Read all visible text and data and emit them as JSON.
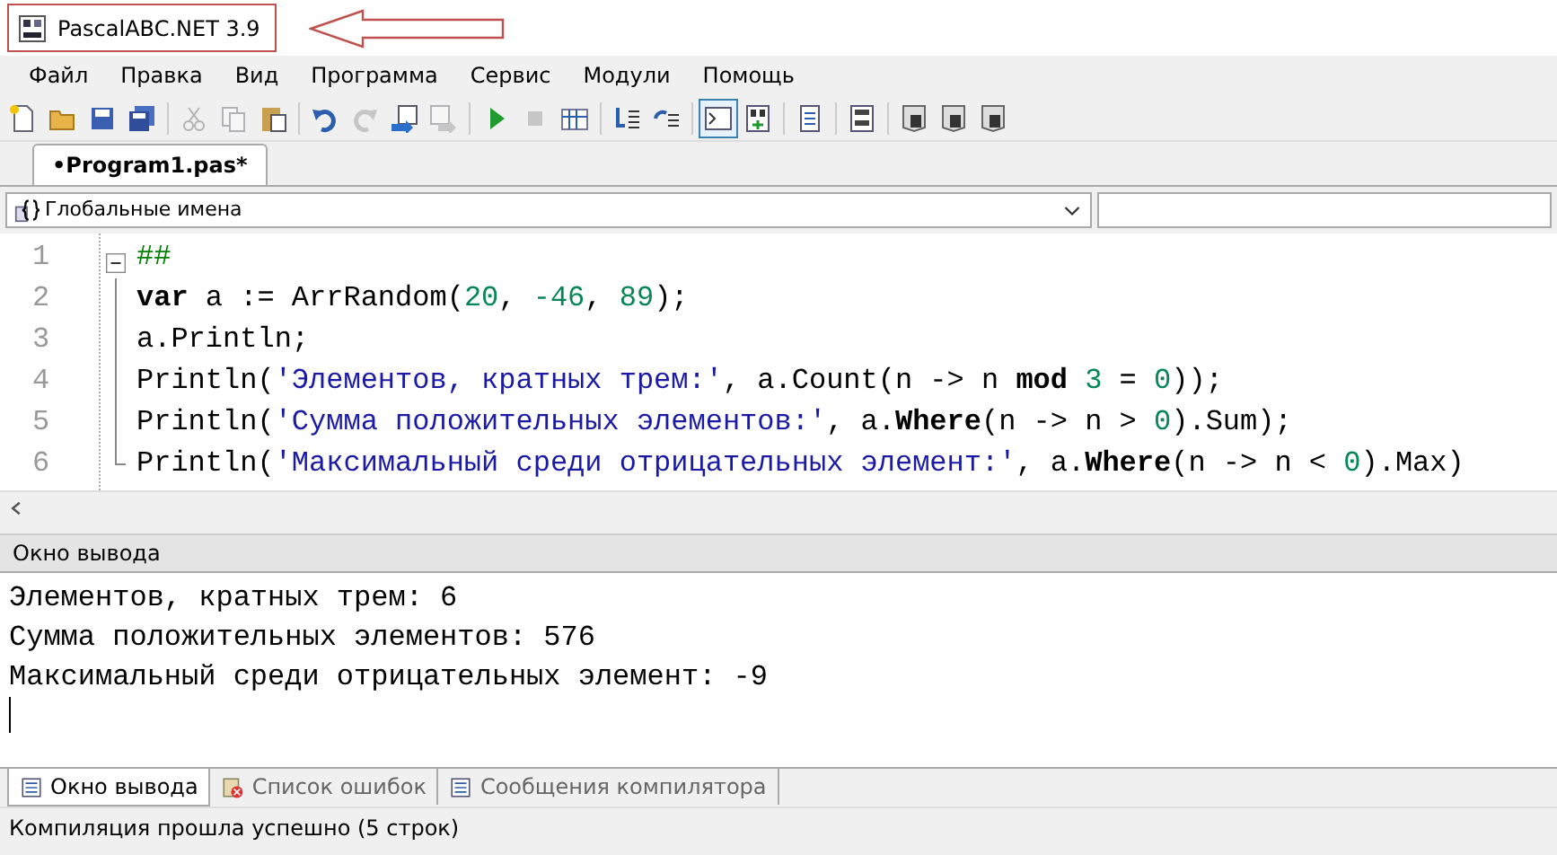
{
  "window": {
    "title": "PascalABC.NET 3.9"
  },
  "menu": [
    "Файл",
    "Правка",
    "Вид",
    "Программа",
    "Сервис",
    "Модули",
    "Помощь"
  ],
  "toolbar": [
    [
      {
        "kind": "new",
        "disabled": false
      },
      {
        "kind": "open",
        "disabled": false
      },
      {
        "kind": "save",
        "disabled": false
      },
      {
        "kind": "save-all",
        "disabled": false
      }
    ],
    [
      {
        "kind": "cut",
        "disabled": true
      },
      {
        "kind": "copy",
        "disabled": true
      },
      {
        "kind": "paste",
        "disabled": false
      }
    ],
    [
      {
        "kind": "undo",
        "disabled": false
      },
      {
        "kind": "redo",
        "disabled": true
      },
      {
        "kind": "doc-left",
        "disabled": false
      },
      {
        "kind": "doc-right",
        "disabled": true
      }
    ],
    [
      {
        "kind": "run",
        "disabled": false
      },
      {
        "kind": "stop",
        "disabled": true
      },
      {
        "kind": "grid",
        "disabled": false
      }
    ],
    [
      {
        "kind": "step-in",
        "disabled": false
      },
      {
        "kind": "step-over",
        "disabled": false
      }
    ],
    [
      {
        "kind": "console",
        "disabled": false,
        "selected": true
      },
      {
        "kind": "abc",
        "disabled": false
      }
    ],
    [
      {
        "kind": "page",
        "disabled": false
      }
    ],
    [
      {
        "kind": "code",
        "disabled": false
      }
    ],
    [
      {
        "kind": "doc",
        "disabled": false
      },
      {
        "kind": "doc",
        "disabled": false
      },
      {
        "kind": "doc",
        "disabled": false
      }
    ]
  ],
  "editor_tabs": [
    {
      "label": "•Program1.pas*",
      "selected": true
    }
  ],
  "scope_selector": {
    "value": "Глобальные имена"
  },
  "code": {
    "fold_expanded": true,
    "lines": [
      {
        "number": "1",
        "tokens": [
          {
            "kind": "comment",
            "text": "##"
          }
        ]
      },
      {
        "number": "2",
        "tokens": [
          {
            "kind": "keyword",
            "text": "var"
          },
          {
            "kind": "plain",
            "text": " a := ArrRandom("
          },
          {
            "kind": "number",
            "text": "20"
          },
          {
            "kind": "plain",
            "text": ", "
          },
          {
            "kind": "number",
            "text": "-46"
          },
          {
            "kind": "plain",
            "text": ", "
          },
          {
            "kind": "number",
            "text": "89"
          },
          {
            "kind": "plain",
            "text": ");"
          }
        ]
      },
      {
        "number": "3",
        "tokens": [
          {
            "kind": "plain",
            "text": "a.Println;"
          }
        ]
      },
      {
        "number": "4",
        "tokens": [
          {
            "kind": "plain",
            "text": "Println("
          },
          {
            "kind": "string",
            "text": "'Элементов, кратных трем:'"
          },
          {
            "kind": "plain",
            "text": ", a.Count(n -> n "
          },
          {
            "kind": "keyword",
            "text": "mod"
          },
          {
            "kind": "number",
            "text": " 3"
          },
          {
            "kind": "plain",
            "text": " = "
          },
          {
            "kind": "number",
            "text": "0"
          },
          {
            "kind": "plain",
            "text": "));"
          }
        ]
      },
      {
        "number": "5",
        "tokens": [
          {
            "kind": "plain",
            "text": "Println("
          },
          {
            "kind": "string",
            "text": "'Сумма положительных элементов:'"
          },
          {
            "kind": "plain",
            "text": ", a."
          },
          {
            "kind": "keyword",
            "text": "Where"
          },
          {
            "kind": "plain",
            "text": "(n -> n > "
          },
          {
            "kind": "number",
            "text": "0"
          },
          {
            "kind": "plain",
            "text": ").Sum);"
          }
        ]
      },
      {
        "number": "6",
        "tokens": [
          {
            "kind": "plain",
            "text": "Println("
          },
          {
            "kind": "string",
            "text": "'Максимальный среди отрицательных элемент:'"
          },
          {
            "kind": "plain",
            "text": ", a."
          },
          {
            "kind": "keyword",
            "text": "Where"
          },
          {
            "kind": "plain",
            "text": "(n -> n < "
          },
          {
            "kind": "number",
            "text": "0"
          },
          {
            "kind": "plain",
            "text": ").Max)"
          }
        ]
      }
    ]
  },
  "output_panel": {
    "title": "Окно вывода",
    "lines": [
      "Элементов, кратных трем: 6",
      "Сумма положительных элементов: 576",
      "Максимальный среди отрицательных элемент: -9"
    ]
  },
  "bottom_tabs": [
    {
      "kind": "output",
      "label": "Окно вывода",
      "selected": true
    },
    {
      "kind": "errors",
      "label": "Список ошибок",
      "selected": false
    },
    {
      "kind": "messages",
      "label": "Сообщения компилятора",
      "selected": false
    }
  ],
  "status_bar": "Компиляция прошла успешно (5 строк)"
}
